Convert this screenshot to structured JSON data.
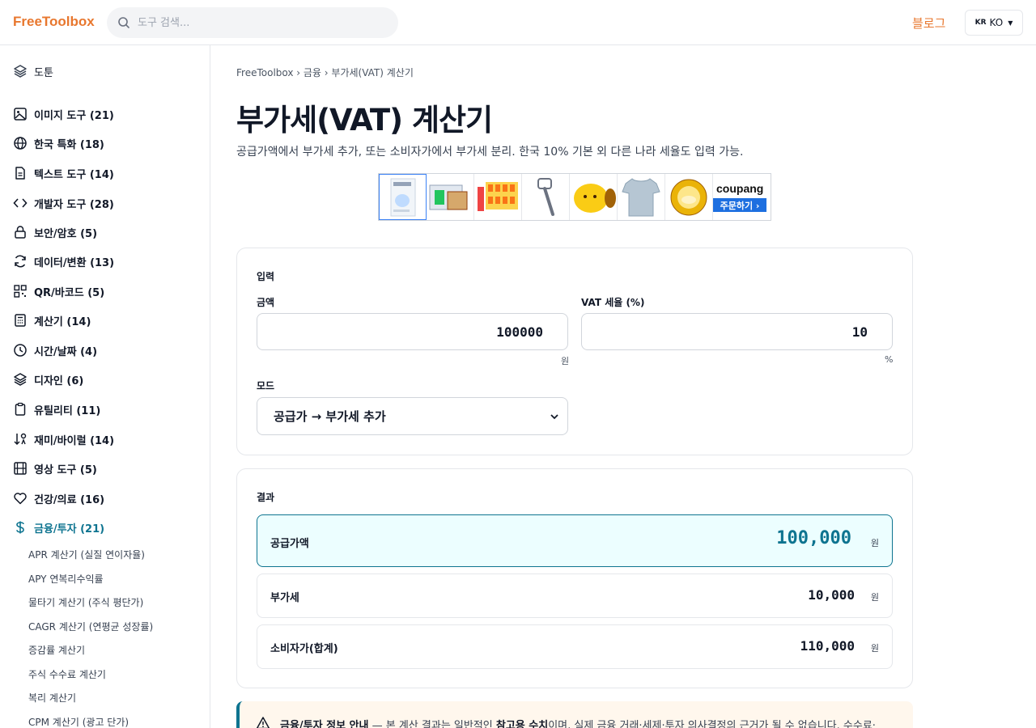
{
  "header": {
    "logo": "FreeToolbox",
    "search_placeholder": "도구 검색...",
    "blog": "블로그",
    "lang_flag": "KR",
    "lang": "KO"
  },
  "sidebar": {
    "top": "도툰",
    "categories": [
      {
        "label": "이미지 도구 (21)",
        "icon": "image-icon"
      },
      {
        "label": "한국 특화 (18)",
        "icon": "globe-icon"
      },
      {
        "label": "텍스트 도구 (14)",
        "icon": "file-text-icon"
      },
      {
        "label": "개발자 도구 (28)",
        "icon": "code-icon"
      },
      {
        "label": "보안/암호 (5)",
        "icon": "lock-icon"
      },
      {
        "label": "데이터/변환 (13)",
        "icon": "refresh-icon"
      },
      {
        "label": "QR/바코드 (5)",
        "icon": "qr-icon"
      },
      {
        "label": "계산기 (14)",
        "icon": "calculator-icon"
      },
      {
        "label": "시간/날짜 (4)",
        "icon": "clock-icon"
      },
      {
        "label": "디자인 (6)",
        "icon": "layers-icon"
      },
      {
        "label": "유틸리티 (11)",
        "icon": "clipboard-icon"
      },
      {
        "label": "재미/바이럴 (14)",
        "icon": "sort-icon"
      },
      {
        "label": "영상 도구 (5)",
        "icon": "film-icon"
      },
      {
        "label": "건강/의료 (16)",
        "icon": "heart-icon"
      },
      {
        "label": "금융/투자 (21)",
        "icon": "dollar-icon"
      }
    ],
    "finance_tools": [
      "APR 계산기 (실질 연이자율)",
      "APY 연복리수익률",
      "물타기 계산기 (주식 평단가)",
      "CAGR 계산기 (연평균 성장률)",
      "증감률 계산기",
      "주식 수수료 계산기",
      "복리 계산기",
      "CPM 계산기 (광고 단가)"
    ]
  },
  "breadcrumb": "FreeToolbox › 금융 › 부가세(VAT) 계산기",
  "title": "부가세(VAT) 계산기",
  "description": "공급가액에서 부가세 추가, 또는 소비자가에서 부가세 분리. 한국 10% 기본 외 다른 나라 세율도 입력 가능.",
  "banner": {
    "brand": "coupang",
    "cta": "주문하기 ›"
  },
  "input": {
    "section": "입력",
    "amount_label": "금액",
    "amount_value": "100000",
    "amount_unit": "원",
    "rate_label": "VAT 세율 (%)",
    "rate_value": "10",
    "rate_unit": "%",
    "mode_label": "모드",
    "mode_value": "공급가 → 부가세 추가"
  },
  "result": {
    "section": "결과",
    "rows": [
      {
        "label": "공급가액",
        "value": "100,000",
        "unit": "원"
      },
      {
        "label": "부가세",
        "value": "10,000",
        "unit": "원"
      },
      {
        "label": "소비자가(합계)",
        "value": "110,000",
        "unit": "원"
      }
    ]
  },
  "notice": {
    "title": "금융/투자 정보 안내",
    "text1": " — 본 계산 결과는 일반적인 ",
    "bold": "참고용 수치",
    "text2": "이며, 실제 금융 거래·세제·투자 의사결정의 근거가 될 수 없습니다. 수수료·"
  },
  "colors": {
    "brand": "#e8772e",
    "accent": "#0e7490",
    "result_bg": "#ecfeff"
  }
}
